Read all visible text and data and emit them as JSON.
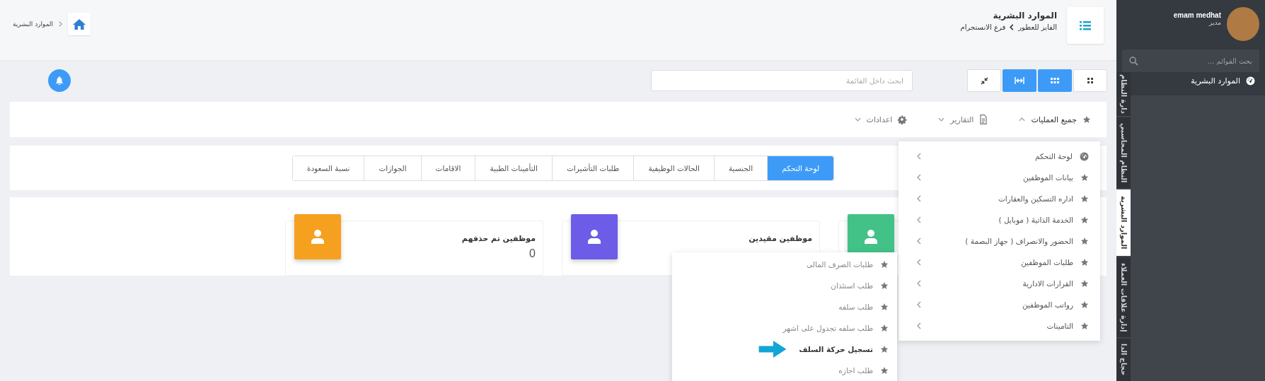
{
  "sidebar": {
    "user": {
      "name": "emam medhat",
      "role": "مدير"
    },
    "search": {
      "placeholder": "بحث القوائم ..."
    },
    "items": [
      {
        "label": "الموارد البشرية"
      }
    ],
    "module_tabs": [
      {
        "label": "دارة النظام",
        "selected": false
      },
      {
        "label": "النظام المحاسبي",
        "selected": false
      },
      {
        "label": "الموارد البشرية",
        "selected": true
      },
      {
        "label": "إدارة علاقات العملاء",
        "selected": false
      },
      {
        "label": "حجاج الدا",
        "selected": false
      }
    ]
  },
  "header": {
    "title": "الموارد البشرية",
    "breadcrumb": [
      "الفايز للعطور",
      "فرع الانستجرام"
    ],
    "home_breadcrumb": "الموارد البشرية"
  },
  "toolbar": {
    "view_buttons": [
      {
        "kind": "dots",
        "selected": false
      },
      {
        "kind": "apps",
        "selected": true
      },
      {
        "kind": "expand",
        "selected": true
      },
      {
        "kind": "compress",
        "selected": false
      }
    ],
    "search": {
      "placeholder": "ابحث داخل القائمة"
    }
  },
  "menu_bar": [
    {
      "label": "جميع العمليات",
      "kind": "star",
      "expanded": true
    },
    {
      "label": "التقارير",
      "kind": "document",
      "expanded": false
    },
    {
      "label": "اعدادات",
      "kind": "gear",
      "expanded": false
    }
  ],
  "tabs": [
    {
      "label": "لوحة التحكم",
      "selected": true
    },
    {
      "label": "الجنسية",
      "selected": false
    },
    {
      "label": "الحالات الوظيفية",
      "selected": false
    },
    {
      "label": "طلبات التأشيرات",
      "selected": false
    },
    {
      "label": "التأمينات الطبية",
      "selected": false
    },
    {
      "label": "الاقامات",
      "selected": false
    },
    {
      "label": "الجوازات",
      "selected": false
    },
    {
      "label": "نسبة السعودة",
      "selected": false
    }
  ],
  "stat_cards": [
    {
      "color": "#43c288"
    },
    {
      "title": "موظفين مقيدين",
      "color": "#6c5ce7"
    },
    {
      "title": "موظفين تم حذفهم",
      "value": "0",
      "color": "#f6a01f"
    }
  ],
  "dropdown": {
    "items": [
      {
        "label": "لوحة التحكم",
        "kind": "dashboard"
      },
      {
        "label": "بيانات الموظفين",
        "kind": "star"
      },
      {
        "label": "اداره التسكين والعقارات",
        "kind": "star"
      },
      {
        "label": "الخدمة الذاتية ( موبايل )",
        "kind": "star"
      },
      {
        "label": "الحضور والانصراف ( جهاز البصمة )",
        "kind": "star"
      },
      {
        "label": "طلبات الموظفين",
        "kind": "star"
      },
      {
        "label": "القرارات الادارية",
        "kind": "star"
      },
      {
        "label": "رواتب الموظفين",
        "kind": "star"
      },
      {
        "label": "التامينات",
        "kind": "star"
      }
    ]
  },
  "submenu": {
    "items": [
      {
        "label": "طلبات الصرف المالى",
        "selected": false
      },
      {
        "label": "طلب استئذان",
        "selected": false
      },
      {
        "label": "طلب سلفه",
        "selected": false
      },
      {
        "label": "طلب سلفه تجدول على اشهر",
        "selected": false
      },
      {
        "label": "تسجيل حركة السلف",
        "selected": true
      },
      {
        "label": "طلب اجازه",
        "selected": false
      }
    ]
  }
}
